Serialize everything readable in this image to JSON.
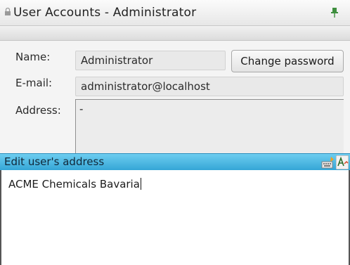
{
  "window": {
    "title": "User Accounts - Administrator"
  },
  "form": {
    "name_label": "Name:",
    "name_value": "Administrator",
    "change_password_label": "Change password",
    "email_label": "E-mail:",
    "email_value": "administrator@localhost",
    "address_label": "Address:",
    "address_value": "-"
  },
  "editor": {
    "header": "Edit user's address",
    "text": "ACME Chemicals Bavaria"
  },
  "colors": {
    "header_blue": "#35a6d6",
    "panel_gray": "#f4f4f4"
  }
}
